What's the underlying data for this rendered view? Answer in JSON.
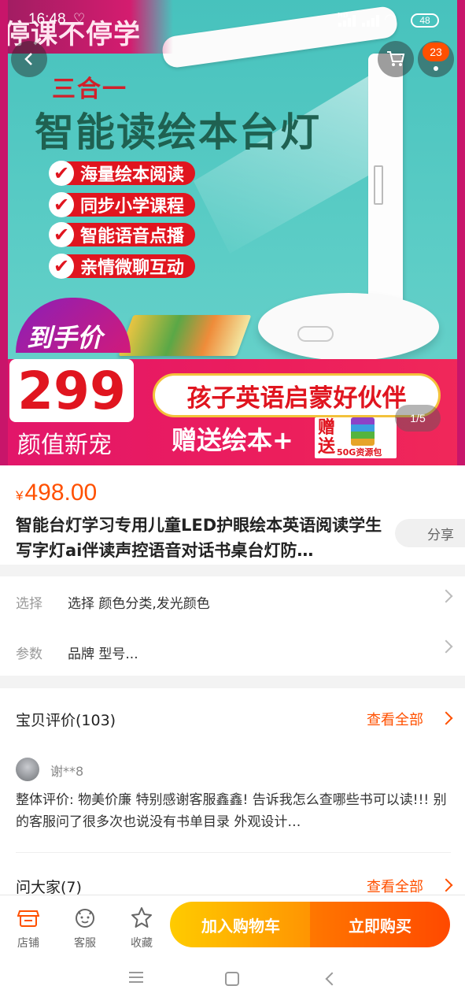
{
  "status_bar": {
    "time": "16:48",
    "battery": "48",
    "network_label": "HD"
  },
  "hero": {
    "banner_top": "停课不停学",
    "subtitle": "三合一",
    "title": "智能读绘本台灯",
    "features": [
      "海量绘本阅读",
      "同步小学课程",
      "智能语音点播",
      "亲情微聊互动"
    ],
    "price_tag": "到手价",
    "price": "299",
    "price_caption": "颜值新宠",
    "slogan": "孩子英语启蒙好伙伴",
    "gift": "赠送绘本+",
    "gift_badge_top": "赠送",
    "gift_badge_bottom": "50G资源包",
    "image_counter": "1/5",
    "cart_badge": "23"
  },
  "product": {
    "currency": "¥",
    "price": "498.00",
    "title": "智能台灯学习专用儿童LED护眼绘本英语阅读学生写字灯ai伴读声控语音对话书桌台灯防…",
    "share_label": "分享"
  },
  "options": [
    {
      "label": "选择",
      "value": "选择 颜色分类,发光颜色"
    },
    {
      "label": "参数",
      "value": "品牌 型号..."
    }
  ],
  "reviews": {
    "title": "宝贝评价(103)",
    "see_all": "查看全部",
    "reviewer": "谢**8",
    "text": "整体评价: 物美价廉 特别感谢客服鑫鑫! 告诉我怎么查哪些书可以读!!! 别的客服问了很多次也说没有书单目录 外观设计…"
  },
  "qa": {
    "title": "问大家(7)",
    "see_all": "查看全部"
  },
  "bottom_bar": {
    "store": "店铺",
    "service": "客服",
    "favorite": "收藏",
    "add_to_cart": "加入购物车",
    "buy_now": "立即购买"
  },
  "colors": {
    "accent": "#ff5000",
    "cart_gradient": "#ffcb00",
    "buy_gradient": "#ff4900"
  }
}
